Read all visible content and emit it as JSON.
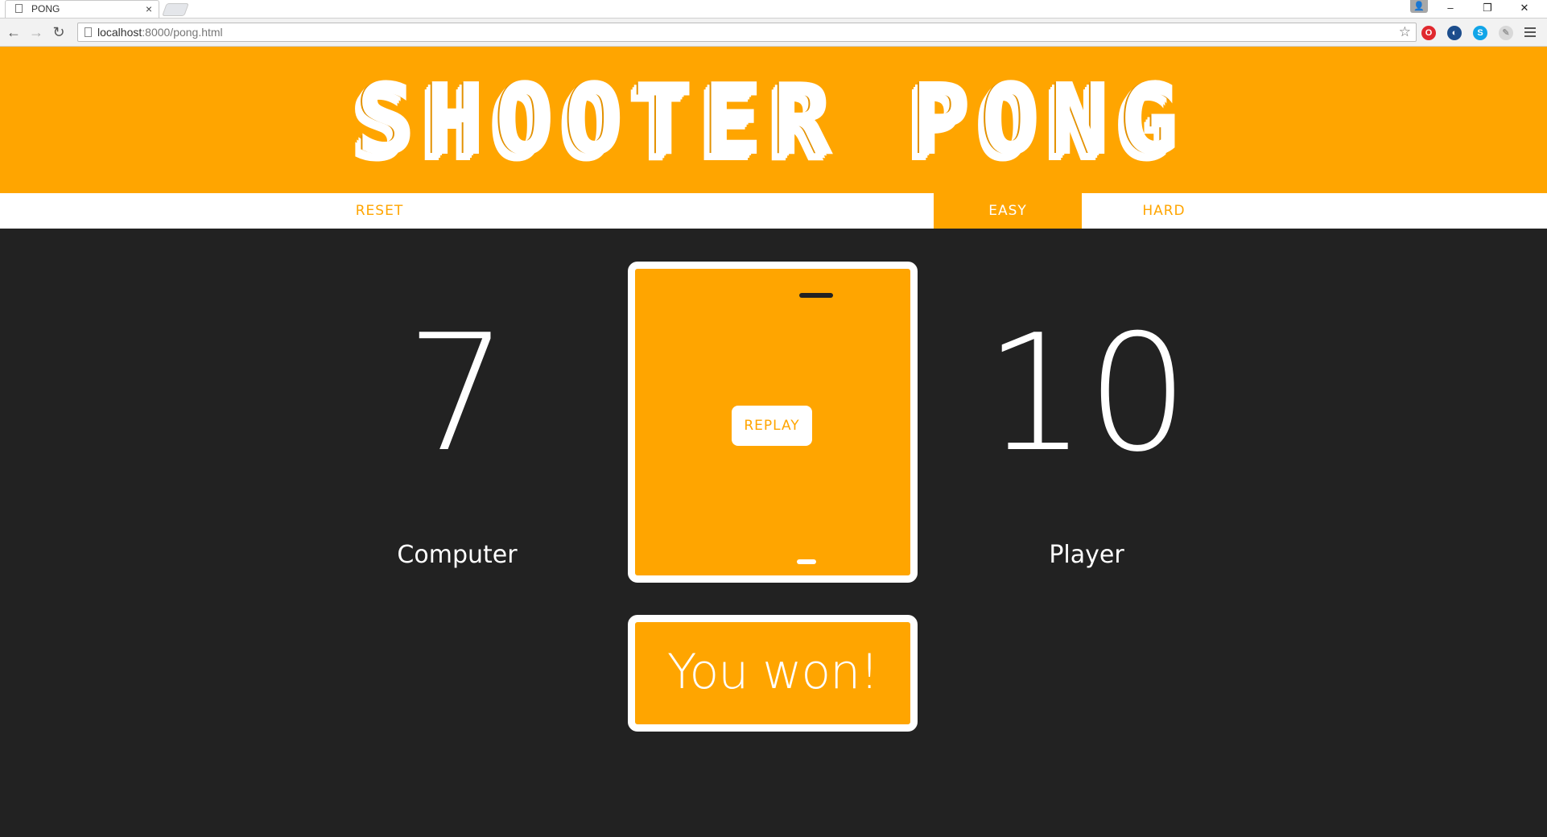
{
  "browser": {
    "tab_title": "PONG",
    "tab_close": "×",
    "url_host": "localhost",
    "url_rest": ":8000/pong.html",
    "window_controls": [
      "–",
      "❐",
      "✕"
    ]
  },
  "header": {
    "logo_text": "SHOOTER PONG"
  },
  "menu": {
    "reset_label": "RESET",
    "easy_label": "EASY",
    "hard_label": "HARD",
    "active": "EASY"
  },
  "scoreboard": {
    "computer_score": "7",
    "computer_label": "Computer",
    "player_score": "10",
    "player_label": "Player"
  },
  "court": {
    "replay_label": "REPLAY"
  },
  "result": {
    "message": "You won!"
  },
  "colors": {
    "accent": "#ffa500",
    "background": "#222222",
    "foreground": "#ffffff"
  }
}
